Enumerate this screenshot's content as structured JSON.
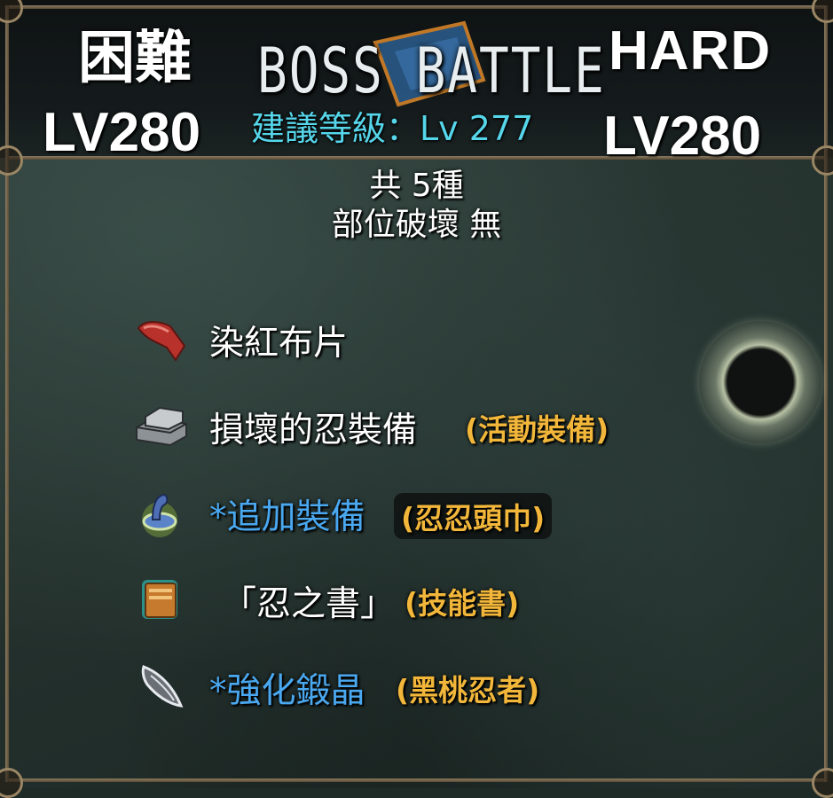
{
  "header": {
    "difficulty_jp": "困難",
    "difficulty_en": "HARD",
    "title": "BOSS BATTLE",
    "level_left": "LV280",
    "level_right": "LV280",
    "recommended_level": "建議等級：Lv 277"
  },
  "summary": {
    "count": "共 5種",
    "part_break": "部位破壞 無"
  },
  "drops": [
    {
      "icon": "red-cloth-icon",
      "name": "染紅布片",
      "tag": ""
    },
    {
      "icon": "metal-ingot-icon",
      "name": "損壞的忍裝備",
      "tag": "(活動裝備)"
    },
    {
      "icon": "ninja-hood-icon",
      "name": "*追加裝備",
      "tag": "(忍忍頭巾)"
    },
    {
      "icon": "skill-book-icon",
      "name": "「忍之書」",
      "tag": "(技能書)"
    },
    {
      "icon": "enhance-crystal-icon",
      "name": "*強化鍛晶",
      "tag": "(黑桃忍者)"
    }
  ],
  "colors": {
    "recommend_text": "#56d6ea",
    "tag_text": "#f2b73a",
    "highlight_name": "#4aa8f0",
    "frame": "#8a7a5e"
  }
}
